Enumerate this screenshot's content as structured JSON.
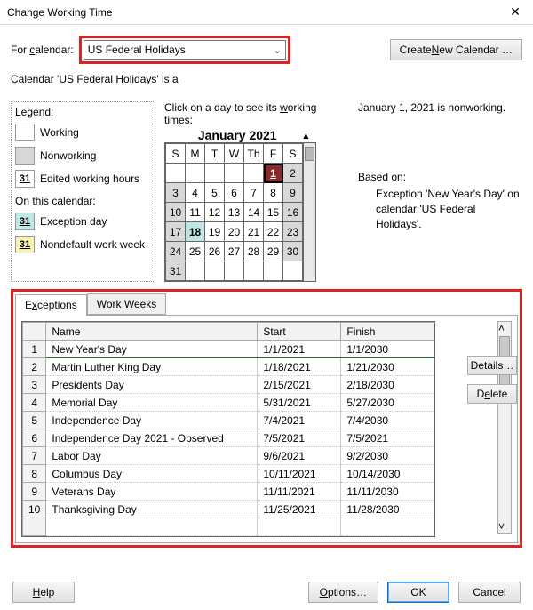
{
  "window": {
    "title": "Change Working Time",
    "close_icon": "✕"
  },
  "top": {
    "for_calendar_label": "For calendar:",
    "for_calendar_label_u": "c",
    "selected_calendar": "US Federal Holidays",
    "create_new_calendar": "Create New Calendar …",
    "create_new_u": "N",
    "description": "Calendar 'US Federal Holidays' is a"
  },
  "legend": {
    "header": "Legend:",
    "working": "Working",
    "nonworking": "Nonworking",
    "edited": "Edited working hours",
    "edited_num": "31",
    "subheader": "On this calendar:",
    "exception_day": "Exception day",
    "exception_num": "31",
    "nondefault_week": "Nondefault work week",
    "nondefault_num": "31"
  },
  "calendar": {
    "hint": "Click on a day to see its working times:",
    "hint_u": "w",
    "caption": "January 2021",
    "up_arrow": "▴",
    "dow": [
      "S",
      "M",
      "T",
      "W",
      "Th",
      "F",
      "S"
    ],
    "weeks": [
      [
        "",
        "",
        "",
        "",
        "",
        "1",
        "2"
      ],
      [
        "3",
        "4",
        "5",
        "6",
        "7",
        "8",
        "9"
      ],
      [
        "10",
        "11",
        "12",
        "13",
        "14",
        "15",
        "16"
      ],
      [
        "17",
        "18",
        "19",
        "20",
        "21",
        "22",
        "23"
      ],
      [
        "24",
        "25",
        "26",
        "27",
        "28",
        "29",
        "30"
      ],
      [
        "31",
        "",
        "",
        "",
        "",
        "",
        ""
      ]
    ]
  },
  "right": {
    "status": "January 1, 2021 is nonworking.",
    "based_on_label": "Based on:",
    "based_on_text": "Exception 'New Year's Day' on calendar 'US Federal Holidays'."
  },
  "tabs": {
    "exceptions": "Exceptions",
    "exceptions_u": "x",
    "work_weeks": "Work Weeks"
  },
  "exceptions": {
    "cols": {
      "name": "Name",
      "start": "Start",
      "finish": "Finish"
    },
    "rows": [
      {
        "n": "1",
        "name": "New Year's Day",
        "start": "1/1/2021",
        "finish": "1/1/2030"
      },
      {
        "n": "2",
        "name": "Martin Luther King Day",
        "start": "1/18/2021",
        "finish": "1/21/2030"
      },
      {
        "n": "3",
        "name": "Presidents Day",
        "start": "2/15/2021",
        "finish": "2/18/2030"
      },
      {
        "n": "4",
        "name": "Memorial Day",
        "start": "5/31/2021",
        "finish": "5/27/2030"
      },
      {
        "n": "5",
        "name": "Independence Day",
        "start": "7/4/2021",
        "finish": "7/4/2030"
      },
      {
        "n": "6",
        "name": "Independence Day 2021 - Observed",
        "start": "7/5/2021",
        "finish": "7/5/2021"
      },
      {
        "n": "7",
        "name": "Labor Day",
        "start": "9/6/2021",
        "finish": "9/2/2030"
      },
      {
        "n": "8",
        "name": "Columbus Day",
        "start": "10/11/2021",
        "finish": "10/14/2030"
      },
      {
        "n": "9",
        "name": "Veterans Day",
        "start": "11/11/2021",
        "finish": "11/11/2030"
      },
      {
        "n": "10",
        "name": "Thanksgiving Day",
        "start": "11/25/2021",
        "finish": "11/28/2030"
      }
    ]
  },
  "actions": {
    "details": "Details…",
    "delete": "Delete"
  },
  "footer": {
    "help": "Help",
    "options": "Options…",
    "ok": "OK",
    "cancel": "Cancel"
  }
}
